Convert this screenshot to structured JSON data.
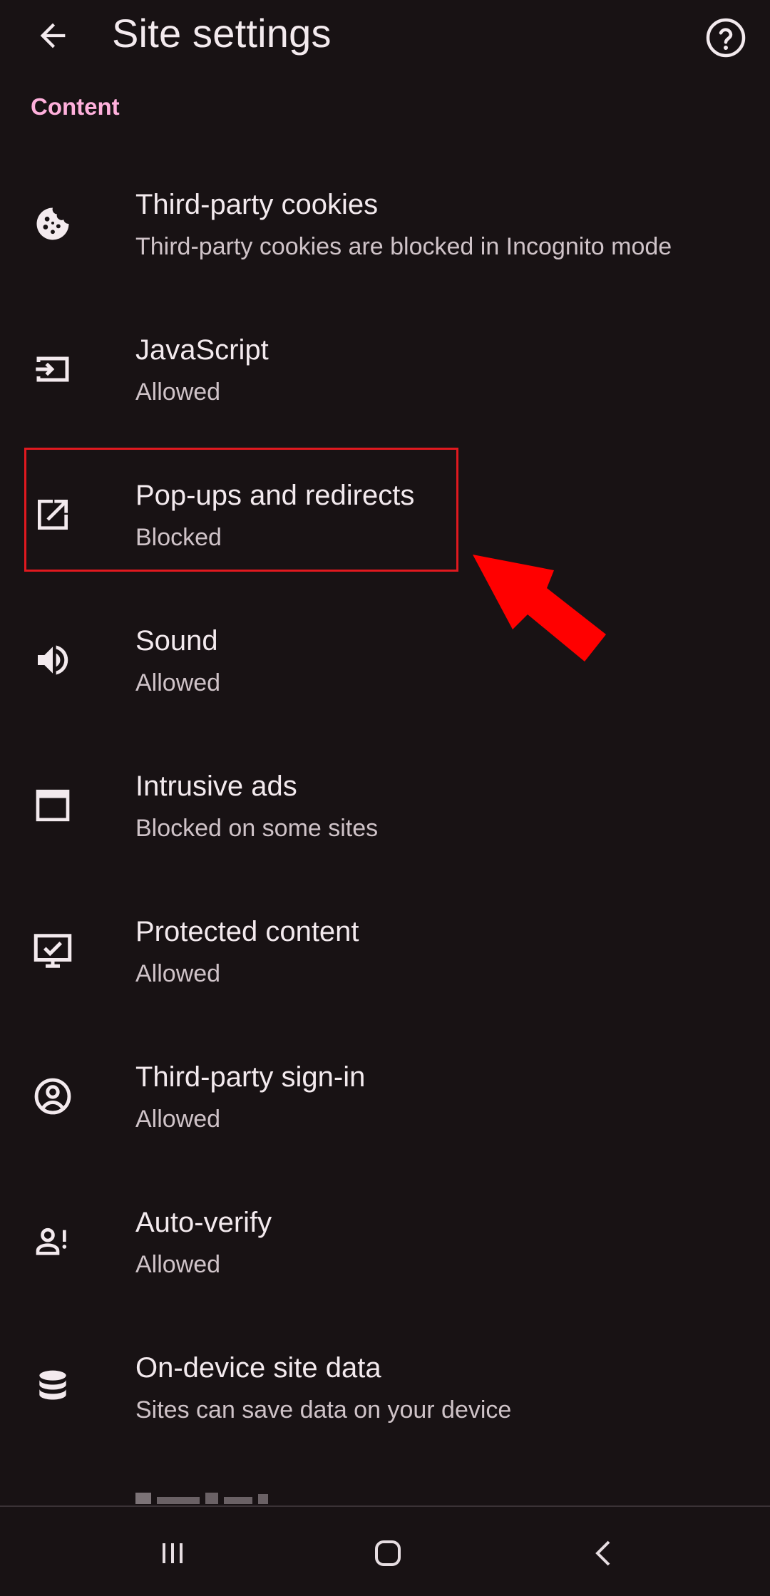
{
  "header": {
    "title": "Site settings"
  },
  "section": {
    "label": "Content"
  },
  "items": [
    {
      "title": "Third-party cookies",
      "subtitle": "Third-party cookies are blocked in Incognito mode",
      "icon": "cookie-icon"
    },
    {
      "title": "JavaScript",
      "subtitle": "Allowed",
      "icon": "javascript-icon"
    },
    {
      "title": "Pop-ups and redirects",
      "subtitle": "Blocked",
      "icon": "open-in-new-icon"
    },
    {
      "title": "Sound",
      "subtitle": "Allowed",
      "icon": "volume-icon"
    },
    {
      "title": "Intrusive ads",
      "subtitle": "Blocked on some sites",
      "icon": "ad-window-icon"
    },
    {
      "title": "Protected content",
      "subtitle": "Allowed",
      "icon": "protected-content-icon"
    },
    {
      "title": "Third-party sign-in",
      "subtitle": "Allowed",
      "icon": "account-circle-icon"
    },
    {
      "title": "Auto-verify",
      "subtitle": "Allowed",
      "icon": "person-alert-icon"
    },
    {
      "title": "On-device site data",
      "subtitle": "Sites can save data on your device",
      "icon": "database-icon"
    }
  ],
  "colors": {
    "background": "#181214",
    "accent": "#ffb0dc",
    "annotation": "#e0191f"
  }
}
